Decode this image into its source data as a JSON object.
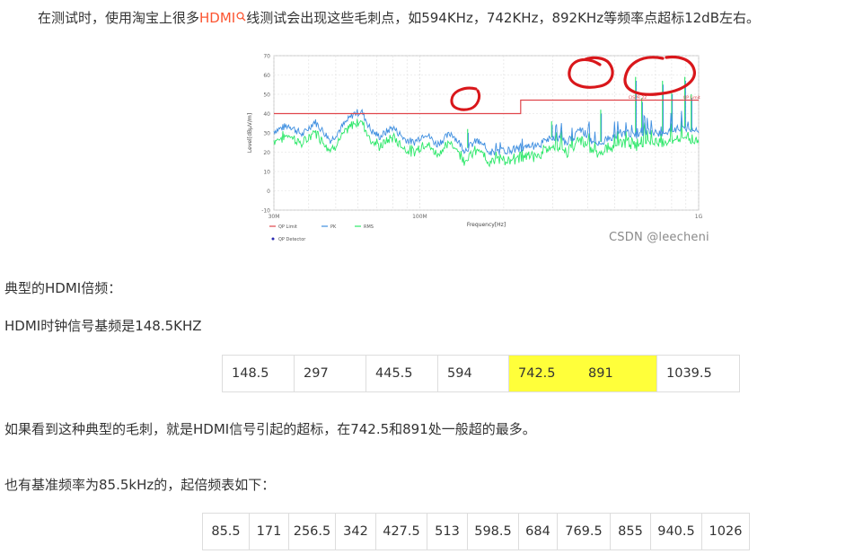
{
  "intro": {
    "before_link": "在测试时，使用淘宝上很多",
    "link_text": "HDMI",
    "after_link": "线测试会出现这些毛刺点，如594KHz，742KHz，892KHz等频率点超标12dB左右。"
  },
  "colors": {
    "highlight": "#ffff3a",
    "link": "#fc5531",
    "qp_limit": "#e0454b",
    "pk": "#3f8fe0",
    "rms": "#2ee86a",
    "annotation": "#d9171b"
  },
  "chart_data": {
    "type": "line",
    "title": "",
    "xlabel": "Frequency[Hz]",
    "ylabel": "Level[dBμV/m]",
    "x_scale": "log",
    "xlim_hz": [
      30000000,
      1000000000
    ],
    "ylim": [
      -10,
      70
    ],
    "y_ticks": [
      -10,
      0,
      10,
      20,
      30,
      40,
      50,
      60,
      70
    ],
    "x_tick_labels": [
      {
        "hz": 30000000,
        "label": "30M"
      },
      {
        "hz": 100000000,
        "label": "100M"
      },
      {
        "hz": 1000000000,
        "label": "1G"
      }
    ],
    "grid": true,
    "limit_labels": [
      "CISPR 22",
      "QP Limit"
    ],
    "qp_limit": [
      {
        "hz": 30000000,
        "level": 40
      },
      {
        "hz": 230000000,
        "level": 40
      },
      {
        "hz": 230000000,
        "level": 47
      },
      {
        "hz": 1000000000,
        "level": 47
      }
    ],
    "pk_baseline": [
      {
        "hz": 30000000,
        "level": 31
      },
      {
        "hz": 34000000,
        "level": 34
      },
      {
        "hz": 38000000,
        "level": 29
      },
      {
        "hz": 42000000,
        "level": 36
      },
      {
        "hz": 48000000,
        "level": 26
      },
      {
        "hz": 54000000,
        "level": 35
      },
      {
        "hz": 58000000,
        "level": 40
      },
      {
        "hz": 62000000,
        "level": 41
      },
      {
        "hz": 67000000,
        "level": 31
      },
      {
        "hz": 72000000,
        "level": 28
      },
      {
        "hz": 80000000,
        "level": 33
      },
      {
        "hz": 88000000,
        "level": 27
      },
      {
        "hz": 95000000,
        "level": 25
      },
      {
        "hz": 105000000,
        "level": 30
      },
      {
        "hz": 115000000,
        "level": 24
      },
      {
        "hz": 130000000,
        "level": 30
      },
      {
        "hz": 145000000,
        "level": 21
      },
      {
        "hz": 160000000,
        "level": 26
      },
      {
        "hz": 180000000,
        "level": 20
      },
      {
        "hz": 205000000,
        "level": 21
      },
      {
        "hz": 235000000,
        "level": 22
      },
      {
        "hz": 270000000,
        "level": 24
      },
      {
        "hz": 300000000,
        "level": 28
      },
      {
        "hz": 340000000,
        "level": 25
      },
      {
        "hz": 380000000,
        "level": 32
      },
      {
        "hz": 420000000,
        "level": 24
      },
      {
        "hz": 480000000,
        "level": 27
      },
      {
        "hz": 540000000,
        "level": 30
      },
      {
        "hz": 600000000,
        "level": 29
      },
      {
        "hz": 660000000,
        "level": 31
      },
      {
        "hz": 720000000,
        "level": 30
      },
      {
        "hz": 800000000,
        "level": 31
      },
      {
        "hz": 880000000,
        "level": 33
      },
      {
        "hz": 950000000,
        "level": 31
      },
      {
        "hz": 1000000000,
        "level": 30
      }
    ],
    "rms_offset_db": -5,
    "peaks": [
      {
        "hz": 148500000,
        "level": 32
      },
      {
        "hz": 297000000,
        "level": 36
      },
      {
        "hz": 445500000,
        "level": 42
      },
      {
        "hz": 594000000,
        "level": 59
      },
      {
        "hz": 625000000,
        "level": 48
      },
      {
        "hz": 742000000,
        "level": 57
      },
      {
        "hz": 800000000,
        "level": 52
      },
      {
        "hz": 892000000,
        "level": 59
      },
      {
        "hz": 940000000,
        "level": 50
      }
    ],
    "legend": [
      {
        "name": "QP Limit",
        "color": "#e0454b",
        "kind": "line"
      },
      {
        "name": "PK",
        "color": "#3f8fe0",
        "kind": "line"
      },
      {
        "name": "RMS",
        "color": "#2ee86a",
        "kind": "line"
      },
      {
        "name": "QP Detector",
        "color": "#2a2ab0",
        "kind": "dot"
      }
    ]
  },
  "watermark": "CSDN @leecheni",
  "p_typical": "典型的HDMI倍频：",
  "p_clock": "HDMI时钟信号基频是148.5KHZ",
  "table1": {
    "cells": [
      "148.5",
      "297",
      "445.5",
      "594",
      "742.5",
      "891",
      "1039.5"
    ],
    "highlighted": [
      4,
      5
    ]
  },
  "p_conclusion": "如果看到这种典型的毛刺，就是HDMI信号引起的超标，在742.5和891处一般超的最多。",
  "p_base855": "也有基准频率为85.5kHz的，起倍频表如下：",
  "table2": {
    "cells": [
      "85.5",
      "171",
      "256.5",
      "342",
      "427.5",
      "513",
      "598.5",
      "684",
      "769.5",
      "855",
      "940.5",
      "1026"
    ]
  }
}
